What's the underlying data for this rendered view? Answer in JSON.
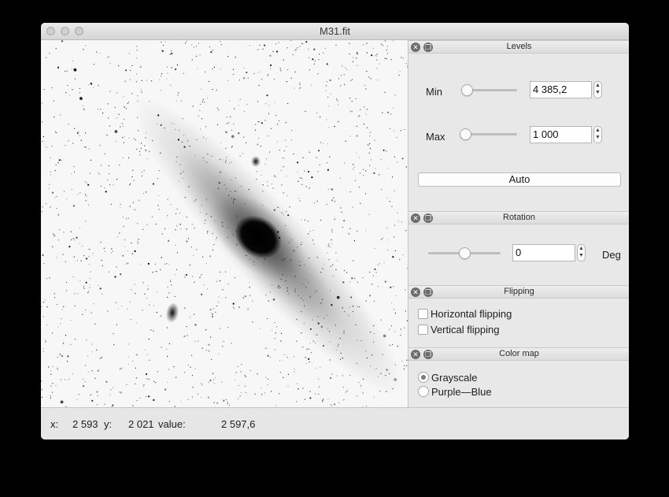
{
  "window": {
    "title": "M31.fit"
  },
  "levels": {
    "title": "Levels",
    "min_label": "Min",
    "min_value": "4 385,2",
    "min_slider_position": 0.05,
    "max_label": "Max",
    "max_value": "1 000",
    "max_slider_position": 0.02,
    "auto_label": "Auto"
  },
  "rotation": {
    "title": "Rotation",
    "value": "0",
    "slider_position": 0.5,
    "unit_label": "Deg"
  },
  "flipping": {
    "title": "Flipping",
    "horizontal_label": "Horizontal flipping",
    "horizontal_checked": false,
    "vertical_label": "Vertical flipping",
    "vertical_checked": false
  },
  "colormap": {
    "title": "Color map",
    "options": [
      {
        "label": "Grayscale",
        "selected": true
      },
      {
        "label": "Purple—Blue",
        "selected": false
      }
    ]
  },
  "status": {
    "x_label": "x:",
    "x_value": "2 593",
    "y_label": "y:",
    "y_value": "2 021",
    "value_label": "value:",
    "value_value": "2 597,6"
  },
  "icons": {
    "dock_close": "close-icon",
    "dock_float": "float-icon"
  }
}
